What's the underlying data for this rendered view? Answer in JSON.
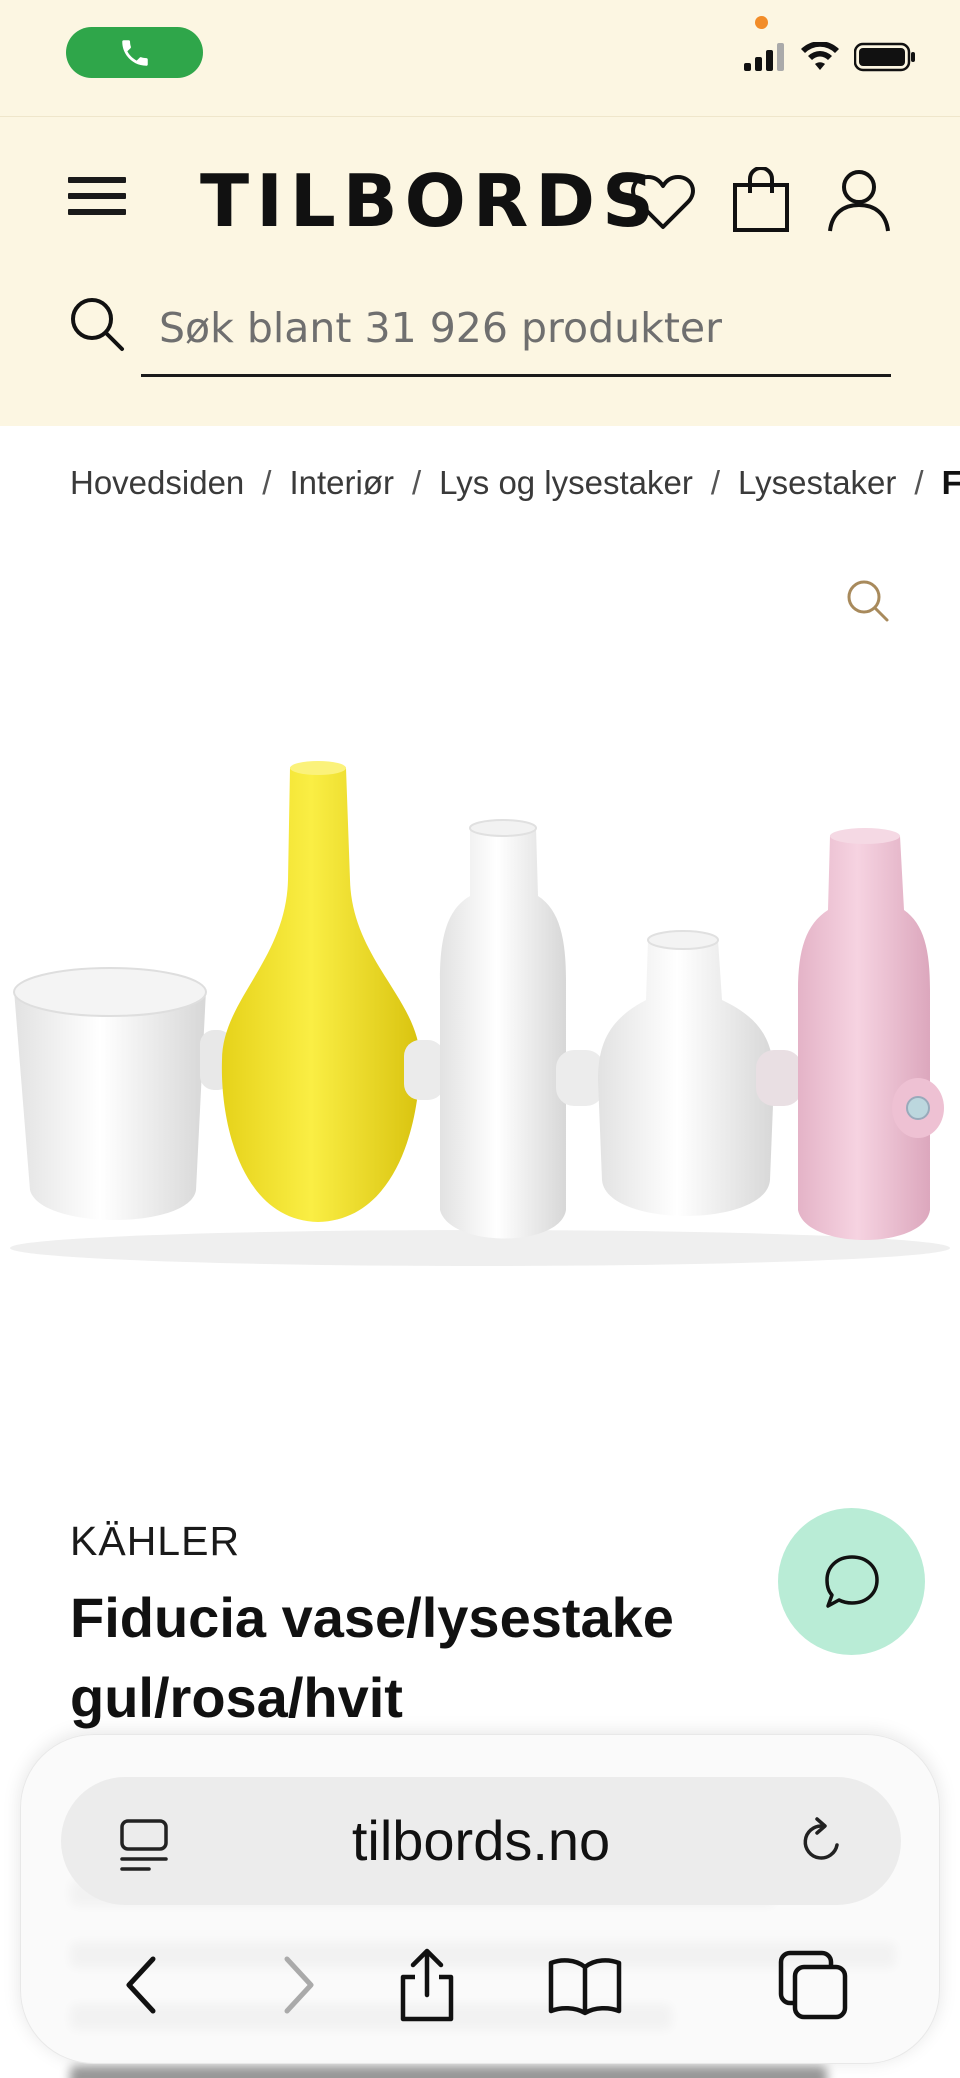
{
  "status_bar": {
    "call_icon": "phone-icon",
    "signal_icon": "cellular-signal-icon",
    "wifi_icon": "wifi-icon",
    "battery_icon": "battery-icon"
  },
  "header": {
    "logo": "TILBORDS",
    "menu_icon": "hamburger-menu-icon",
    "wishlist_icon": "heart-icon",
    "cart_icon": "shopping-bag-icon",
    "account_icon": "user-icon"
  },
  "search": {
    "placeholder": "Søk blant 31 926 produkter",
    "value": ""
  },
  "breadcrumb": {
    "items": [
      "Hovedsiden",
      "Interiør",
      "Lys og lysestaker",
      "Lysestaker"
    ],
    "current": "Fid",
    "separator": "/"
  },
  "product": {
    "brand": "KÄHLER",
    "title": "Fiducia vase/lysestake gul/rosa/hvit",
    "colors": {
      "yellow": "#f2e22a",
      "pink": "#f1c6d8",
      "white": "#f7f7f7"
    }
  },
  "browser": {
    "url": "tilbords.no"
  },
  "colors": {
    "header_bg": "#fcf6e2",
    "chat_button": "#b9ecd6",
    "call_pill": "#2fa64a"
  }
}
